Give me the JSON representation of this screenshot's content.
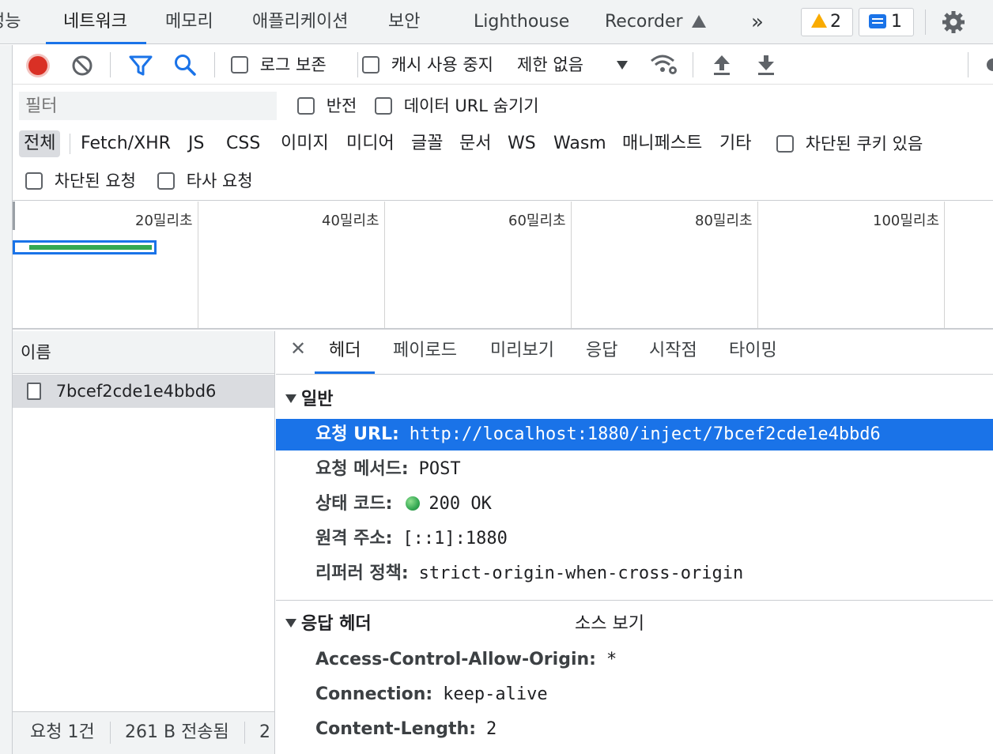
{
  "tabs": [
    {
      "label": "성능"
    },
    {
      "label": "네트워크"
    },
    {
      "label": "메모리"
    },
    {
      "label": "애플리케이션"
    },
    {
      "label": "보안"
    },
    {
      "label": "Lighthouse"
    },
    {
      "label": "Recorder"
    }
  ],
  "badges": {
    "warnings": "2",
    "messages": "1"
  },
  "toolbar": {
    "preserve_log": "로그 보존",
    "disable_cache": "캐시 사용 중지",
    "throttling": "제한 없음"
  },
  "filter": {
    "placeholder": "필터",
    "invert": "반전",
    "hide_data_urls": "데이터 URL 숨기기",
    "types": [
      "전체",
      "Fetch/XHR",
      "JS",
      "CSS",
      "이미지",
      "미디어",
      "글꼴",
      "문서",
      "WS",
      "Wasm",
      "매니페스트",
      "기타"
    ],
    "blocked_cookies": "차단된 쿠키 있음",
    "blocked_requests": "차단된 요청",
    "third_party": "타사 요청"
  },
  "overview": {
    "ticks": [
      "20밀리초",
      "40밀리초",
      "60밀리초",
      "80밀리초",
      "100밀리초"
    ]
  },
  "name_pane": {
    "header": "이름",
    "requests": [
      "7bcef2cde1e4bbd6"
    ],
    "footer": {
      "count": "요청 1건",
      "transferred": "261 B 전송됨",
      "extra": "2"
    }
  },
  "detail": {
    "tabs": [
      "헤더",
      "페이로드",
      "미리보기",
      "응답",
      "시작점",
      "타이밍"
    ],
    "general_title": "일반",
    "general": [
      {
        "key": "요청 URL:",
        "value": "http://localhost:1880/inject/7bcef2cde1e4bbd6"
      },
      {
        "key": "요청 메서드:",
        "value": "POST"
      },
      {
        "key": "상태 코드:",
        "value": "200 OK"
      },
      {
        "key": "원격 주소:",
        "value": "[::1]:1880"
      },
      {
        "key": "리퍼러 정책:",
        "value": "strict-origin-when-cross-origin"
      }
    ],
    "response_title": "응답 헤더",
    "view_source": "소스 보기",
    "response": [
      {
        "key": "Access-Control-Allow-Origin:",
        "value": "*"
      },
      {
        "key": "Connection:",
        "value": "keep-alive"
      },
      {
        "key": "Content-Length:",
        "value": "2"
      }
    ]
  },
  "colors": {
    "accent": "#1a73e8",
    "record": "#d93025",
    "status_ok": "#34a853"
  }
}
